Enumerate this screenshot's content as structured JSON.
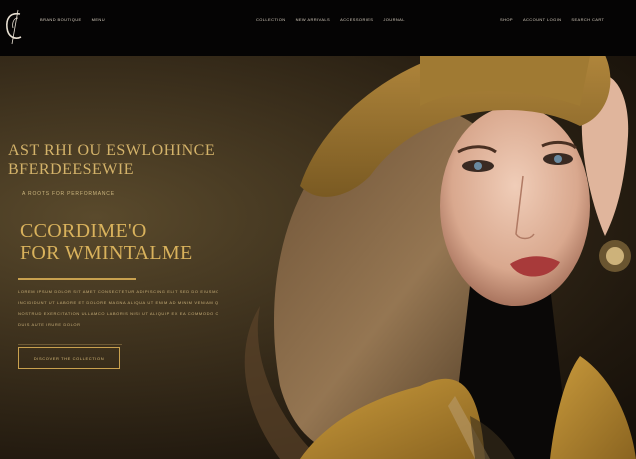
{
  "brand": {
    "logo_icon": "c-monogram-icon"
  },
  "nav": {
    "left": [
      "BRAND BOUTIQUE",
      "MENU"
    ],
    "center": [
      "COLLECTION",
      "NEW ARRIVALS",
      "ACCESSORIES",
      "JOURNAL"
    ],
    "right": [
      "SHOP",
      "ACCOUNT LOGIN",
      "SEARCH CART"
    ]
  },
  "hero": {
    "headline": [
      "AST RHI OU ESWLOHINCE",
      "BFERDEESEWIE"
    ],
    "subline": "A  ROOTS  FOR  PERFORMANCE",
    "title": [
      "CCORDIME'O",
      "FOR WMINTALME"
    ],
    "body": [
      "LOREM IPSUM DOLOR SIT AMET CONSECTETUR ADIPISCING ELIT SED DO EIUSMOD TEMPOR",
      "INCIDIDUNT UT LABORE ET DOLORE MAGNA ALIQUA UT ENIM AD MINIM VENIAM QUIS",
      "NOSTRUD EXERCITATION ULLAMCO LABORIS NISI UT ALIQUIP EX EA COMMODO CONSEQUAT",
      "DUIS AUTE IRURE DOLOR"
    ],
    "cta_label": "DISCOVER THE COLLECTION"
  },
  "colors": {
    "accent": "#d4b36a",
    "background": "#3b2f1c",
    "topbar": "#050404"
  }
}
